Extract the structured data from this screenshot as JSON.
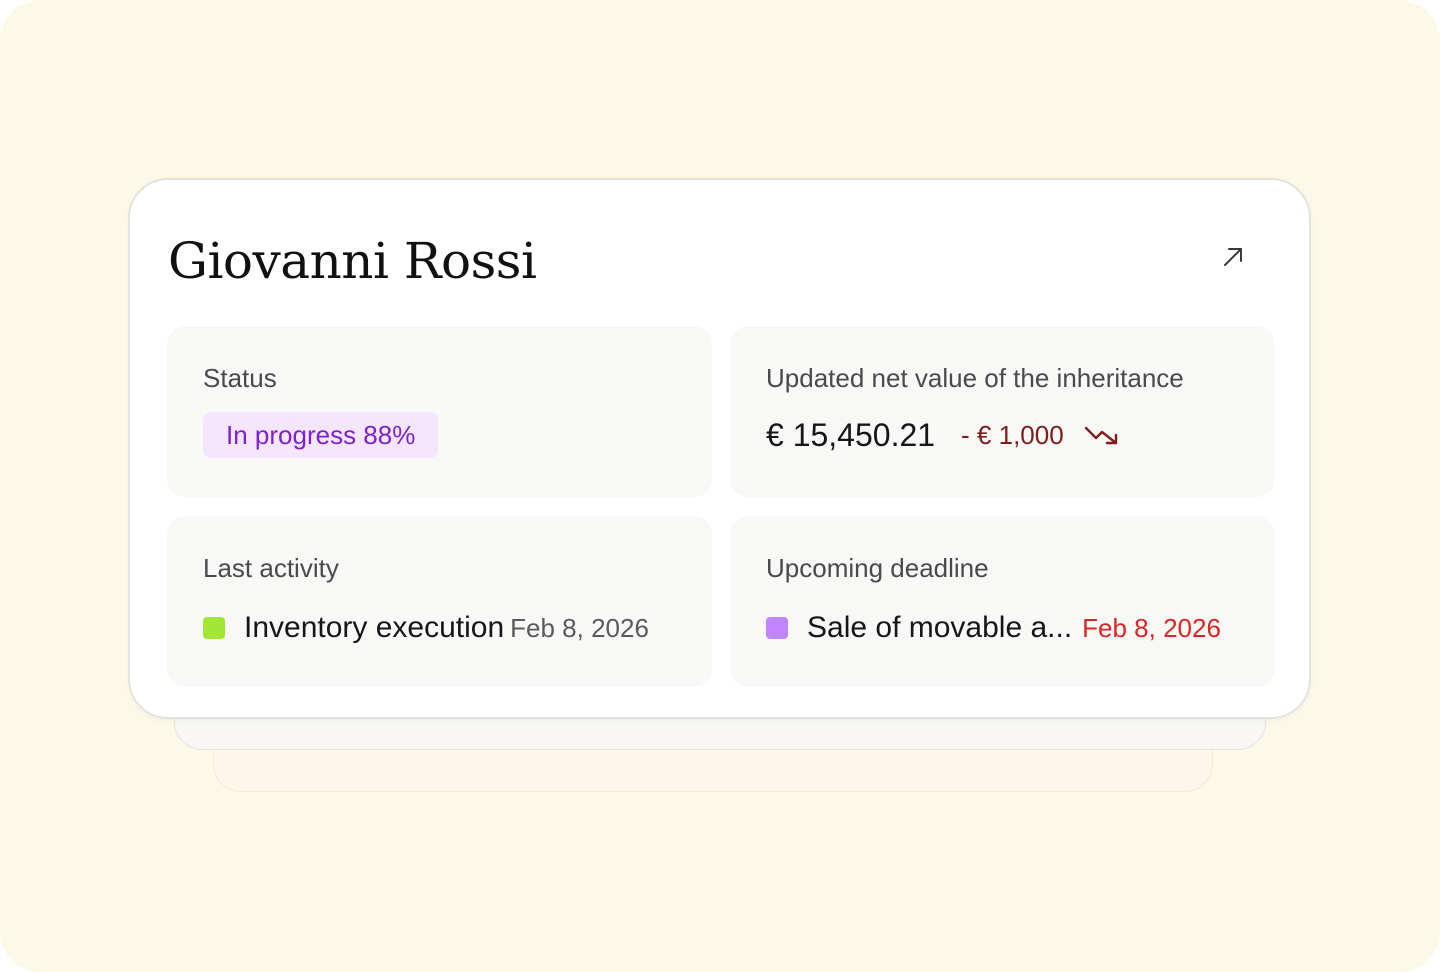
{
  "card": {
    "title": "Giovanni Rossi",
    "open_icon": "arrow-up-right-icon"
  },
  "status": {
    "label": "Status",
    "badge_text": "In progress 88%",
    "progress_percent": 88,
    "badge_bg": "#f3e6fd",
    "badge_color": "#7e22ce"
  },
  "net_value": {
    "label": "Updated net value of the inheritance",
    "amount": "€ 15,450.21",
    "delta": "- € 1,000",
    "delta_color": "#7f1d1d",
    "trend_icon": "trending-down-icon"
  },
  "last_activity": {
    "label": "Last activity",
    "item_text": "Inventory execution",
    "item_date": "Feb 8, 2026",
    "square_color": "#a3e635",
    "date_color": "#5a5a5a"
  },
  "upcoming_deadline": {
    "label": "Upcoming deadline",
    "item_text": "Sale of movable a...",
    "item_date": "Feb 8, 2026",
    "square_color": "#c084fc",
    "date_color": "#dc2626"
  }
}
